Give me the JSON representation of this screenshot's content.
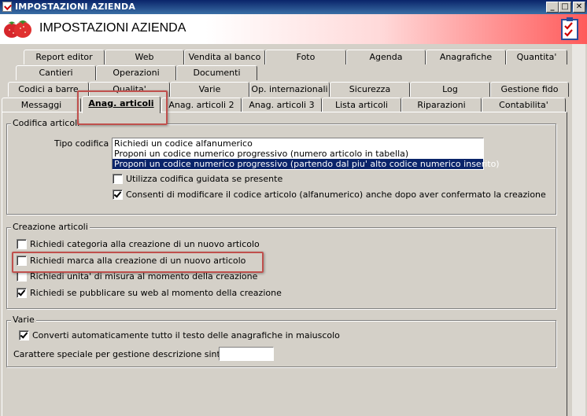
{
  "window": {
    "title": "IMPOSTAZIONI AZIENDA",
    "controls": {
      "minimize": "_",
      "maximize": "□",
      "close": "✕"
    }
  },
  "header": {
    "title": "IMPOSTAZIONI AZIENDA"
  },
  "tabs": {
    "row1": [
      "Report editor",
      "Web",
      "Vendita al banco",
      "Foto",
      "Agenda",
      "Anagrafiche",
      "Quantita'"
    ],
    "row2": [
      "Cantieri",
      "Operazioni",
      "Documenti"
    ],
    "row3": [
      "Codici a barre",
      "Qualita'",
      "Varie",
      "Op. internazionali",
      "Sicurezza",
      "Log",
      "Gestione fido"
    ],
    "row4": [
      "Messaggi",
      "Anag. articoli",
      "Anag. articoli 2",
      "Anag. articoli 3",
      "Lista articoli",
      "Riparazioni",
      "Contabilita'"
    ],
    "active": "Anag. articoli"
  },
  "codifica": {
    "legend": "Codifica articoli",
    "tipo_label": "Tipo codifica :",
    "options": [
      "Richiedi un codice alfanumerico",
      "Proponi un codice numerico progressivo (numero articolo in tabella)",
      "Proponi un codice numerico progressivo (partendo dal piu' alto codice numerico inserito)"
    ],
    "selected_index": 2,
    "check_guidata": {
      "label": "Utilizza codifica guidata se presente",
      "checked": false
    },
    "check_modifica": {
      "label": "Consenti di modificare il codice articolo (alfanumerico) anche dopo aver confermato la creazione",
      "checked": true
    }
  },
  "creazione": {
    "legend": "Creazione articoli",
    "items": [
      {
        "label": "Richiedi categoria alla creazione di un nuovo articolo",
        "checked": false
      },
      {
        "label": "Richiedi marca alla creazione di un nuovo articolo",
        "checked": false
      },
      {
        "label": "Richiedi unita' di misura al momento della creazione",
        "checked": false
      },
      {
        "label": "Richiedi se pubblicare su web al momento della creazione",
        "checked": true
      }
    ]
  },
  "varie": {
    "legend": "Varie",
    "check_maiuscolo": {
      "label": "Converti automaticamente tutto il testo delle anagrafiche in maiuscolo",
      "checked": true
    },
    "carattere_label": "Carattere speciale per gestione descrizione sintetica :",
    "carattere_value": ""
  },
  "colors": {
    "highlight": "#c0504d",
    "selection": "#0a246a",
    "titlebar": "#0a246a"
  }
}
